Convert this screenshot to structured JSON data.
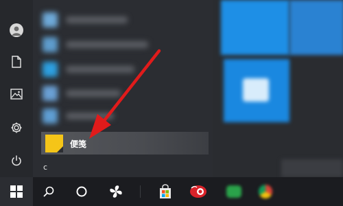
{
  "start_menu": {
    "pinned_app": {
      "label": "便笺",
      "icon": "sticky-notes-icon",
      "accent": "#f5c518"
    },
    "section_header": "c",
    "rail_icons": [
      "user-avatar-icon",
      "document-icon",
      "pictures-icon",
      "settings-icon",
      "power-icon"
    ]
  },
  "taskbar": {
    "icons": [
      "windows-start-icon",
      "search-icon",
      "cortana-icon",
      "pinwheel-app-icon",
      "microsoft-store-icon",
      "red-app-icon",
      "green-app-icon",
      "browser-icon"
    ]
  },
  "colors": {
    "annotation_arrow": "#e01b1b",
    "tile_blue": "#1e8fe6"
  }
}
